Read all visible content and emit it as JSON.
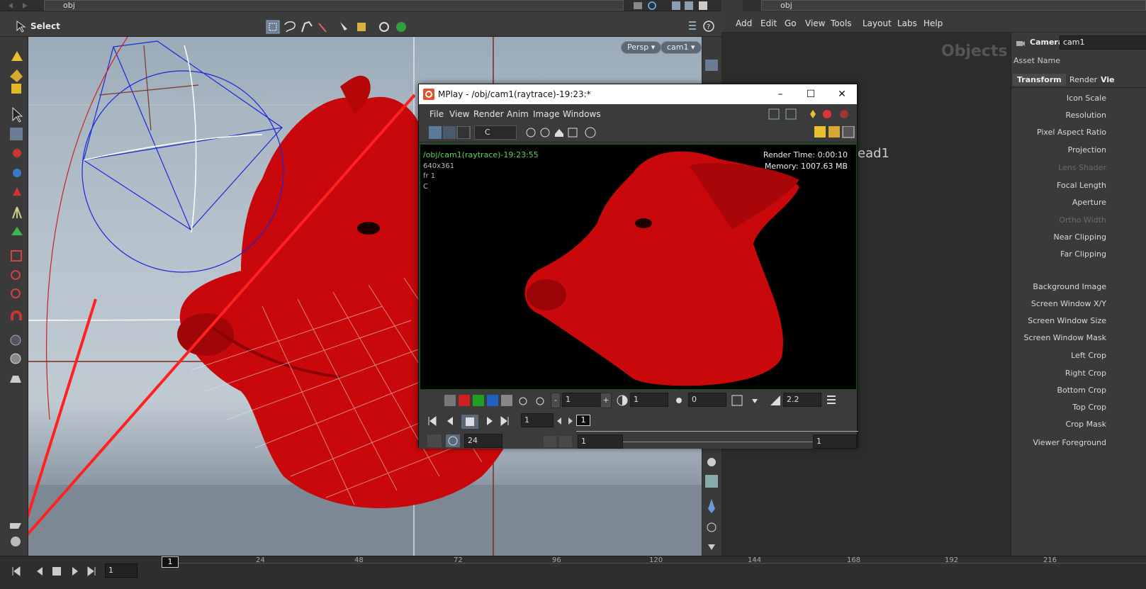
{
  "top_path_left": "obj",
  "top_path_right": "obj",
  "viewport_toolbar": {
    "select_label": "Select"
  },
  "viewport": {
    "persp_label": "Persp",
    "cam_label": "cam1"
  },
  "menu_bar": {
    "items": [
      "Add",
      "Edit",
      "Go",
      "View",
      "Tools",
      "Layout",
      "Labs",
      "Help"
    ]
  },
  "network": {
    "context_label": "Objects",
    "partial_node_label": "ead1"
  },
  "params": {
    "node_type": "Camera",
    "node_name": "cam1",
    "asset_name_label": "Asset Name",
    "tabs": [
      "Transform",
      "Render",
      "Vie"
    ],
    "labels": [
      {
        "text": "Icon Scale",
        "dim": false
      },
      {
        "text": "Resolution",
        "dim": false
      },
      {
        "text": "Pixel Aspect Ratio",
        "dim": false
      },
      {
        "text": "Projection",
        "dim": false
      },
      {
        "text": "Lens Shader",
        "dim": true
      },
      {
        "text": "Focal Length",
        "dim": false
      },
      {
        "text": "Aperture",
        "dim": false
      },
      {
        "text": "Ortho Width",
        "dim": true
      },
      {
        "text": "Near Clipping",
        "dim": false
      },
      {
        "text": "Far Clipping",
        "dim": false
      },
      {
        "text": "Background Image",
        "dim": false
      },
      {
        "text": "Screen Window X/Y",
        "dim": false
      },
      {
        "text": "Screen Window Size",
        "dim": false
      },
      {
        "text": "Screen Window Mask",
        "dim": false
      },
      {
        "text": "Left Crop",
        "dim": false
      },
      {
        "text": "Right Crop",
        "dim": false
      },
      {
        "text": "Bottom Crop",
        "dim": false
      },
      {
        "text": "Top Crop",
        "dim": false
      },
      {
        "text": "Crop Mask",
        "dim": false
      },
      {
        "text": "Viewer Foreground",
        "dim": false
      }
    ]
  },
  "mplay": {
    "title": "MPlay - /obj/cam1(raytrace)-19:23:*",
    "menu": [
      "File",
      "View",
      "Render",
      "Anim",
      "Image",
      "Windows"
    ],
    "channel": "C",
    "overlay": {
      "path": "/obj/cam1(raytrace)-19:23:55",
      "resolution": "640x361",
      "frame": "fr 1",
      "plane": "C",
      "render_time": "Render Time: 0:00:10",
      "memory": "Memory: 1007.63 MB"
    },
    "controls": {
      "step_value": "1",
      "exposure_value": "1",
      "offset_value": "0",
      "gamma_value": "2.2",
      "frame_value": "1",
      "fps_value": "24",
      "start_frame": "1",
      "end_frame": "1",
      "timeline_frame": "1"
    }
  },
  "timeline": {
    "current_frame": "1",
    "frame_field": "1",
    "ticks": [
      "24",
      "48",
      "72",
      "96",
      "120",
      "144",
      "168",
      "192",
      "216"
    ]
  },
  "colors": {
    "pig_red": "#c8080a",
    "arrow_red": "#ff2020",
    "overlay_green": "#5bd35b",
    "camera_blue": "#1a28d8"
  }
}
